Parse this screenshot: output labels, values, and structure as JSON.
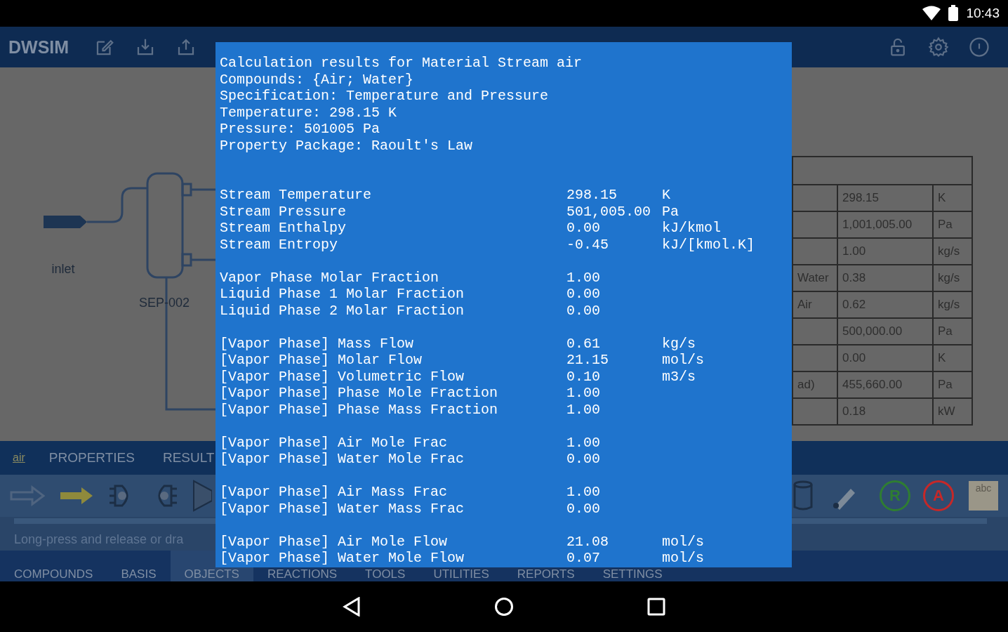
{
  "status_bar": {
    "time": "10:43"
  },
  "app_bar": {
    "title": "DWSIM"
  },
  "flowsheet": {
    "stream_label": "inlet",
    "separator_label": "SEP-002"
  },
  "summary_table": {
    "rows": [
      {
        "value": "298.15",
        "unit": "K"
      },
      {
        "value": "1,001,005.00",
        "unit": "Pa"
      },
      {
        "value": "1.00",
        "unit": "kg/s"
      },
      {
        "column_1": "Water",
        "value": "0.38",
        "unit": "kg/s"
      },
      {
        "column_1": "Air",
        "value": "0.62",
        "unit": "kg/s"
      },
      {
        "value": "500,000.00",
        "unit": "Pa"
      },
      {
        "value": "0.00",
        "unit": "K"
      },
      {
        "column_1": "ad)",
        "value": "455,660.00",
        "unit": "Pa"
      },
      {
        "value": "0.18",
        "unit": "kW"
      }
    ]
  },
  "object_bar": {
    "object_name": "air",
    "tabs": [
      "PROPERTIES",
      "RESULT"
    ]
  },
  "palette": {
    "badges": [
      {
        "label": "R",
        "color": "#2f7d32"
      },
      {
        "label": "A",
        "color": "#c62828"
      }
    ],
    "note_label": "abc",
    "hint": "Long-press and release or dra"
  },
  "bottom_tabs": [
    {
      "label": "COMPOUNDS",
      "selected": false
    },
    {
      "label": "BASIS",
      "selected": false
    },
    {
      "label": "OBJECTS",
      "selected": true
    },
    {
      "label": "REACTIONS",
      "selected": false
    },
    {
      "label": "TOOLS",
      "selected": false
    },
    {
      "label": "UTILITIES",
      "selected": false
    },
    {
      "label": "REPORTS",
      "selected": false
    },
    {
      "label": "SETTINGS",
      "selected": false
    }
  ],
  "results_dialog": {
    "header": [
      "Calculation results for Material Stream air",
      "Compounds: {Air; Water}",
      "Specification: Temperature and Pressure",
      "Temperature: 298.15 K",
      "Pressure: 501005 Pa",
      "Property Package: Raoult's Law"
    ],
    "groups": [
      [
        {
          "label": "Stream Temperature",
          "value": "298.15",
          "unit": "K"
        },
        {
          "label": "Stream Pressure",
          "value": "501,005.00",
          "unit": "Pa"
        },
        {
          "label": "Stream Enthalpy",
          "value": "0.00",
          "unit": "kJ/kmol"
        },
        {
          "label": "Stream Entropy",
          "value": "-0.45",
          "unit": "kJ/[kmol.K]"
        }
      ],
      [
        {
          "label": "Vapor Phase Molar Fraction",
          "value": "1.00"
        },
        {
          "label": "Liquid Phase 1 Molar Fraction",
          "value": "0.00"
        },
        {
          "label": "Liquid Phase 2 Molar Fraction",
          "value": "0.00"
        }
      ],
      [
        {
          "label": "[Vapor Phase] Mass Flow",
          "value": "0.61",
          "unit": "kg/s"
        },
        {
          "label": "[Vapor Phase] Molar Flow",
          "value": "21.15",
          "unit": "mol/s"
        },
        {
          "label": "[Vapor Phase] Volumetric Flow",
          "value": "0.10",
          "unit": "m3/s"
        },
        {
          "label": "[Vapor Phase] Phase Mole Fraction",
          "value": "1.00"
        },
        {
          "label": "[Vapor Phase] Phase Mass Fraction",
          "value": "1.00"
        }
      ],
      [
        {
          "label": "[Vapor Phase] Air Mole Frac",
          "value": "1.00"
        },
        {
          "label": "[Vapor Phase] Water Mole Frac",
          "value": "0.00"
        }
      ],
      [
        {
          "label": "[Vapor Phase] Air Mass Frac",
          "value": "1.00"
        },
        {
          "label": "[Vapor Phase] Water Mass Frac",
          "value": "0.00"
        }
      ],
      [
        {
          "label": "[Vapor Phase] Air Mole Flow",
          "value": "21.08",
          "unit": "mol/s"
        },
        {
          "label": "[Vapor Phase] Water Mole Flow",
          "value": "0.07",
          "unit": "mol/s"
        }
      ]
    ]
  }
}
